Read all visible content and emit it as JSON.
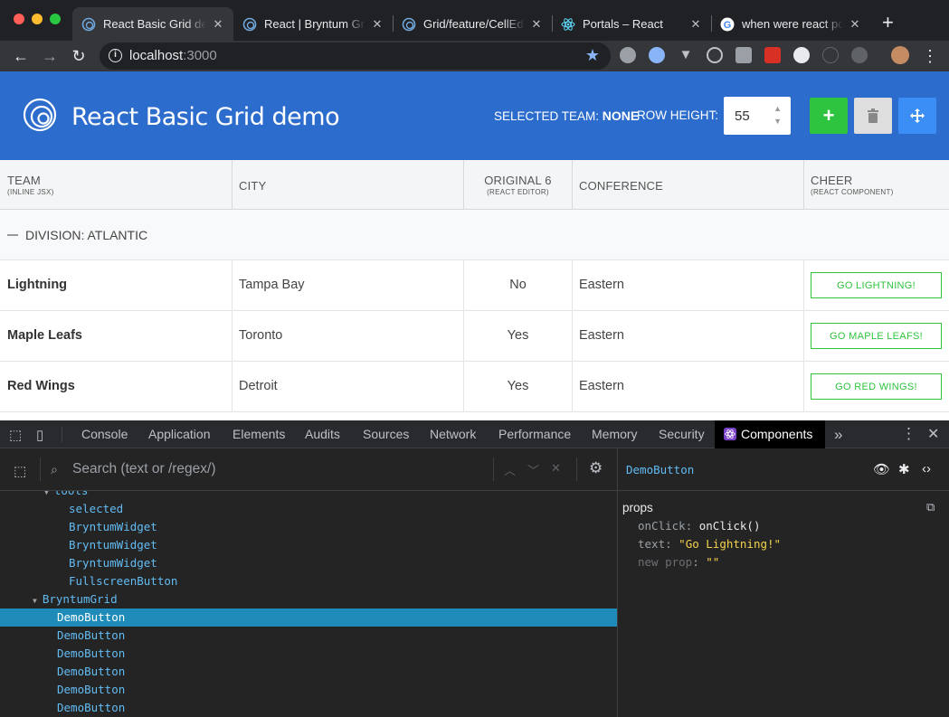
{
  "browser": {
    "tabs": [
      {
        "title": "React Basic Grid demo",
        "active": true
      },
      {
        "title": "React | Bryntum Grid"
      },
      {
        "title": "Grid/feature/CellEdit"
      },
      {
        "title": "Portals – React"
      },
      {
        "title": "when were react portals"
      }
    ],
    "url_host": "localhost",
    "url_port": ":3000",
    "icons": [
      "back-icon",
      "forward-icon",
      "reload-icon",
      "info-icon",
      "star-icon"
    ]
  },
  "app": {
    "title": "React Basic Grid demo",
    "selected_team_label": "SELECTED TEAM:",
    "selected_team_value": "NONE",
    "row_height_label": "ROW HEIGHT:",
    "row_height_value": "55",
    "buttons": {
      "add": "+",
      "delete": "trash-icon",
      "fullscreen": "move-icon"
    },
    "accent": "#2b6ccc"
  },
  "grid": {
    "columns": [
      {
        "label": "TEAM",
        "sub": "(INLINE JSX)"
      },
      {
        "label": "CITY",
        "sub": ""
      },
      {
        "label": "ORIGINAL 6",
        "sub": "(REACT EDITOR)"
      },
      {
        "label": "CONFERENCE",
        "sub": ""
      },
      {
        "label": "CHEER",
        "sub": "(REACT COMPONENT)"
      }
    ],
    "group_label": "DIVISION: ATLANTIC",
    "rows": [
      {
        "team": "Lightning",
        "city": "Tampa Bay",
        "original6": "No",
        "conference": "Eastern",
        "cheer": "GO LIGHTNING!"
      },
      {
        "team": "Maple Leafs",
        "city": "Toronto",
        "original6": "Yes",
        "conference": "Eastern",
        "cheer": "GO MAPLE LEAFS!"
      },
      {
        "team": "Red Wings",
        "city": "Detroit",
        "original6": "Yes",
        "conference": "Eastern",
        "cheer": "GO RED WINGS!"
      }
    ]
  },
  "devtools": {
    "tabs": [
      "Console",
      "Application",
      "Elements",
      "Audits",
      "Sources",
      "Network",
      "Performance",
      "Memory",
      "Security",
      "Components"
    ],
    "active_tab": "Components",
    "more": "»",
    "search_placeholder": "Search (text or /regex/)",
    "tree": [
      {
        "label": "tools",
        "depth": 0,
        "arrow": true
      },
      {
        "label": "selected",
        "depth": 1
      },
      {
        "label": "BryntumWidget",
        "depth": 1
      },
      {
        "label": "BryntumWidget",
        "depth": 1
      },
      {
        "label": "BryntumWidget",
        "depth": 1
      },
      {
        "label": "FullscreenButton",
        "depth": 1
      },
      {
        "label": "BryntumGrid",
        "depth": -1,
        "arrow": true
      },
      {
        "label": "DemoButton",
        "depth": 0,
        "selected": true
      },
      {
        "label": "DemoButton",
        "depth": 0
      },
      {
        "label": "DemoButton",
        "depth": 0
      },
      {
        "label": "DemoButton",
        "depth": 0
      },
      {
        "label": "DemoButton",
        "depth": 0
      },
      {
        "label": "DemoButton",
        "depth": 0
      }
    ],
    "selected_component": "DemoButton",
    "props_title": "props",
    "props": [
      {
        "key": "onClick",
        "value": "onClick()",
        "kind": "fn"
      },
      {
        "key": "text",
        "value": "\"Go Lightning!\"",
        "kind": "str"
      },
      {
        "key": "new prop",
        "value": "\"\"",
        "kind": "new"
      }
    ]
  }
}
